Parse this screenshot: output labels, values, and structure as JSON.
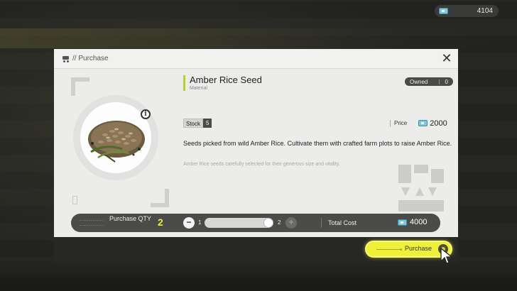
{
  "currency_top": {
    "icon": "ticket-icon",
    "amount": "4104"
  },
  "modal": {
    "header": {
      "icon": "cart-icon",
      "title": "// Purchase",
      "close_icon": "close-icon"
    },
    "item": {
      "name": "Amber Rice Seed",
      "type": "Material",
      "owned_label": "Owned",
      "owned_value": "0",
      "stock_label": "Stock",
      "stock_value": "5",
      "price_label": "Price",
      "price_icon": "ticket-icon",
      "price_value": "2000",
      "description": "Seeds picked from wild Amber Rice. Cultivate them with crafted farm plots to raise Amber Rice.",
      "flavor": "Amber Rice seeds carefully selected for their generous size and vitality.",
      "image": "amber-rice-seed-icon",
      "info_icon": "info-icon"
    },
    "quantity": {
      "label": "Purchase QTY",
      "value": "2",
      "min": "1",
      "max": "2",
      "slider_fraction": 1.0
    },
    "total": {
      "label": "Total Cost",
      "icon": "ticket-icon",
      "value": "4000"
    },
    "purchase_button": {
      "label": "Purchase"
    }
  },
  "colors": {
    "accent_yellow": "#eef03a",
    "qty_yellow": "#e6ec3c",
    "name_accent_green": "#b3d335",
    "panel_bg": "#ececeb",
    "dark_bar": "#4b4b49"
  }
}
